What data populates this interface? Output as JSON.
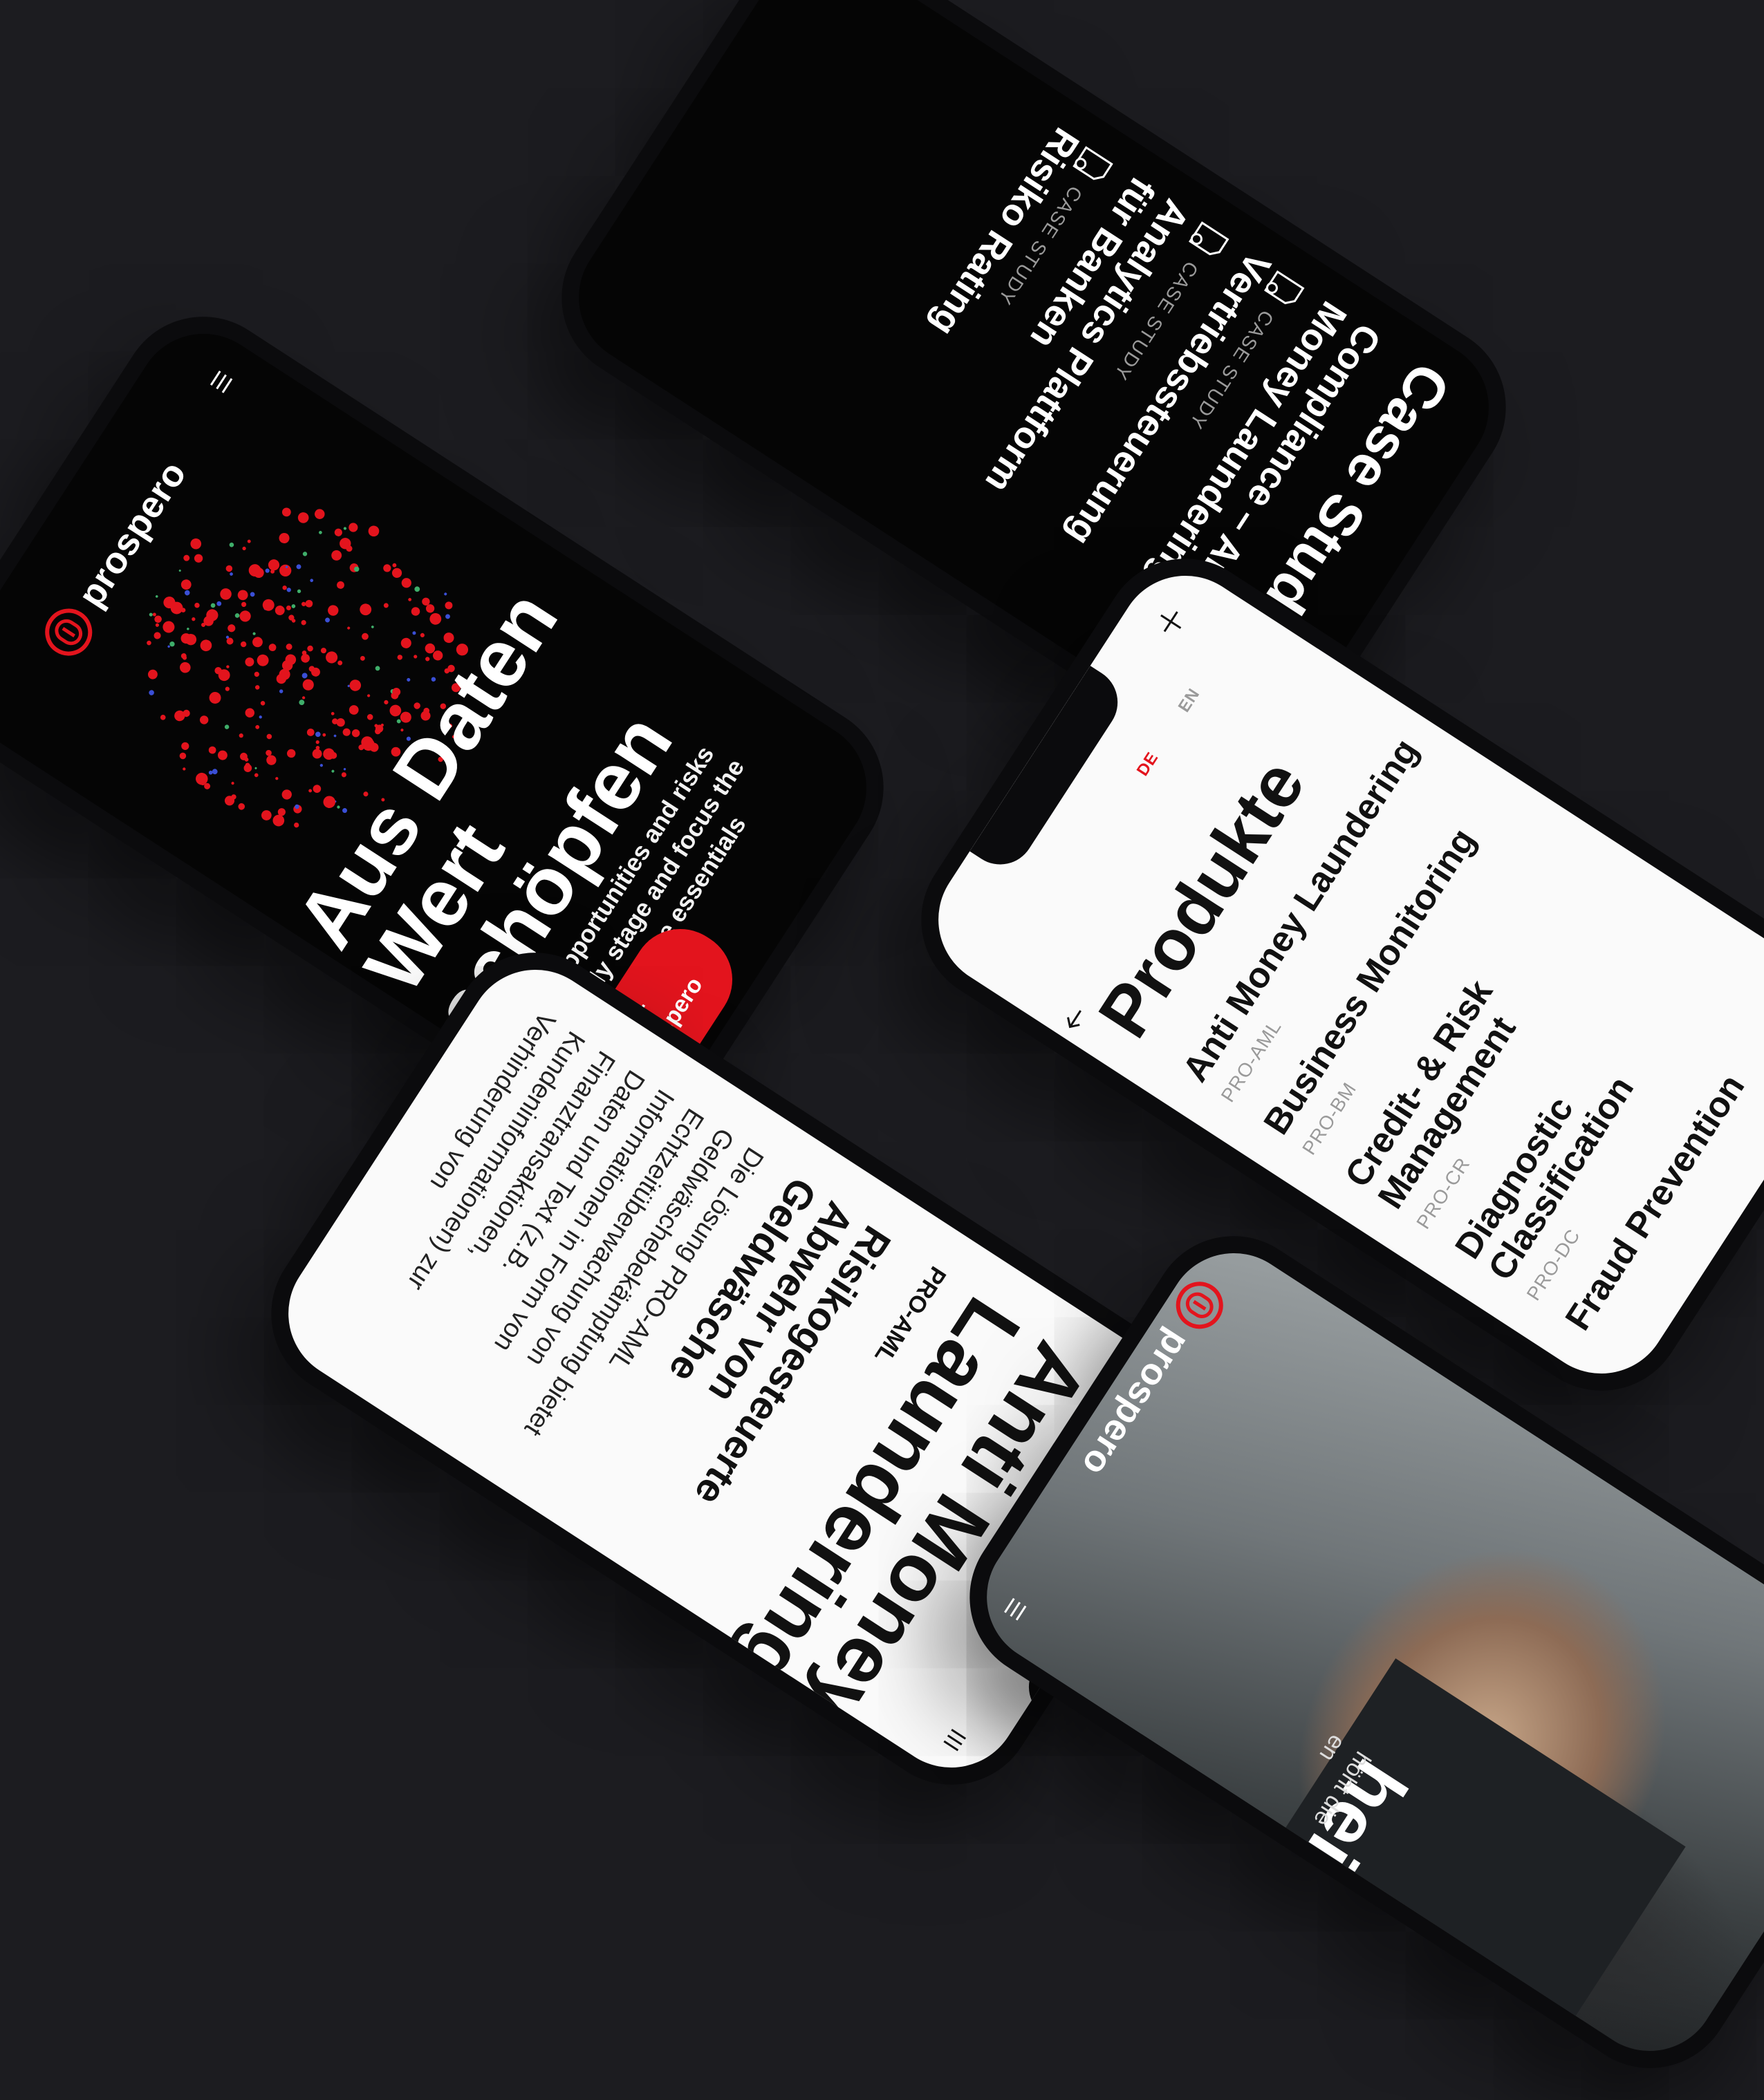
{
  "colors": {
    "background": "#1c1c20",
    "accent": "#e3141d",
    "dark_screen": "#050505",
    "light_screen": "#fafafa"
  },
  "phone_hero": {
    "brand": "prospero",
    "menu_icon": "burger-icon",
    "title_lines": [
      "Aus Daten",
      "Wert",
      "schöpfen"
    ],
    "subtitle_lines": [
      "Detect opportunities and risks",
      "at an early stage and focus the",
      "business on the essentials"
    ],
    "cta_label": "Über Prospero"
  },
  "phone_cases": {
    "title": "Case Studies",
    "items": [
      {
        "title_lines": [
          "Compliance – Anti",
          "Money Laundering"
        ],
        "tag": "CASE STUDY"
      },
      {
        "title_lines": [
          "Vertriebssteuerung"
        ],
        "tag": "CASE STUDY"
      },
      {
        "title_lines": [
          "Analytics Plattform",
          "für Banken"
        ],
        "tag": "CASE STUDY"
      },
      {
        "title_lines": [
          "Risiko Rating"
        ],
        "tag": ""
      }
    ]
  },
  "phone_products": {
    "lang_de": "DE",
    "lang_en": "EN",
    "heading": "Produkte",
    "items": [
      {
        "title_lines": [
          "Anti Money Laundering"
        ],
        "code": "PRO-AML"
      },
      {
        "title_lines": [
          "Business Monitoring"
        ],
        "code": "PRO-BM"
      },
      {
        "title_lines": [
          "Credit- & Risk",
          "Management"
        ],
        "code": "PRO-CR"
      },
      {
        "title_lines": [
          "Diagnostic",
          "Classification"
        ],
        "code": "PRO-DC"
      },
      {
        "title_lines": [
          "Fraud Prevention"
        ],
        "code": ""
      }
    ]
  },
  "phone_aml": {
    "brand": "prospero",
    "title_lines": [
      "Anti Money",
      "Laundering"
    ],
    "code": "PRO-AML",
    "subtitle_lines": [
      "Risikogesteuerte",
      "Abwehr von",
      "Geldwäsche"
    ],
    "body_lines": [
      "Die Lösung PRO-AML",
      "Geldwäschebekämpfung bietet",
      "Echtzeitüberwachung von",
      "Informationen in Form von",
      "Daten und Text (z.B.",
      "Finanztransaktionen,",
      "Kundeninformationen) zur",
      "Verhinderung von"
    ]
  },
  "phone_photo": {
    "brand": "prospero",
    "partial_title": "heit",
    "partial_text_lines": [
      "höht die",
      "en"
    ]
  }
}
